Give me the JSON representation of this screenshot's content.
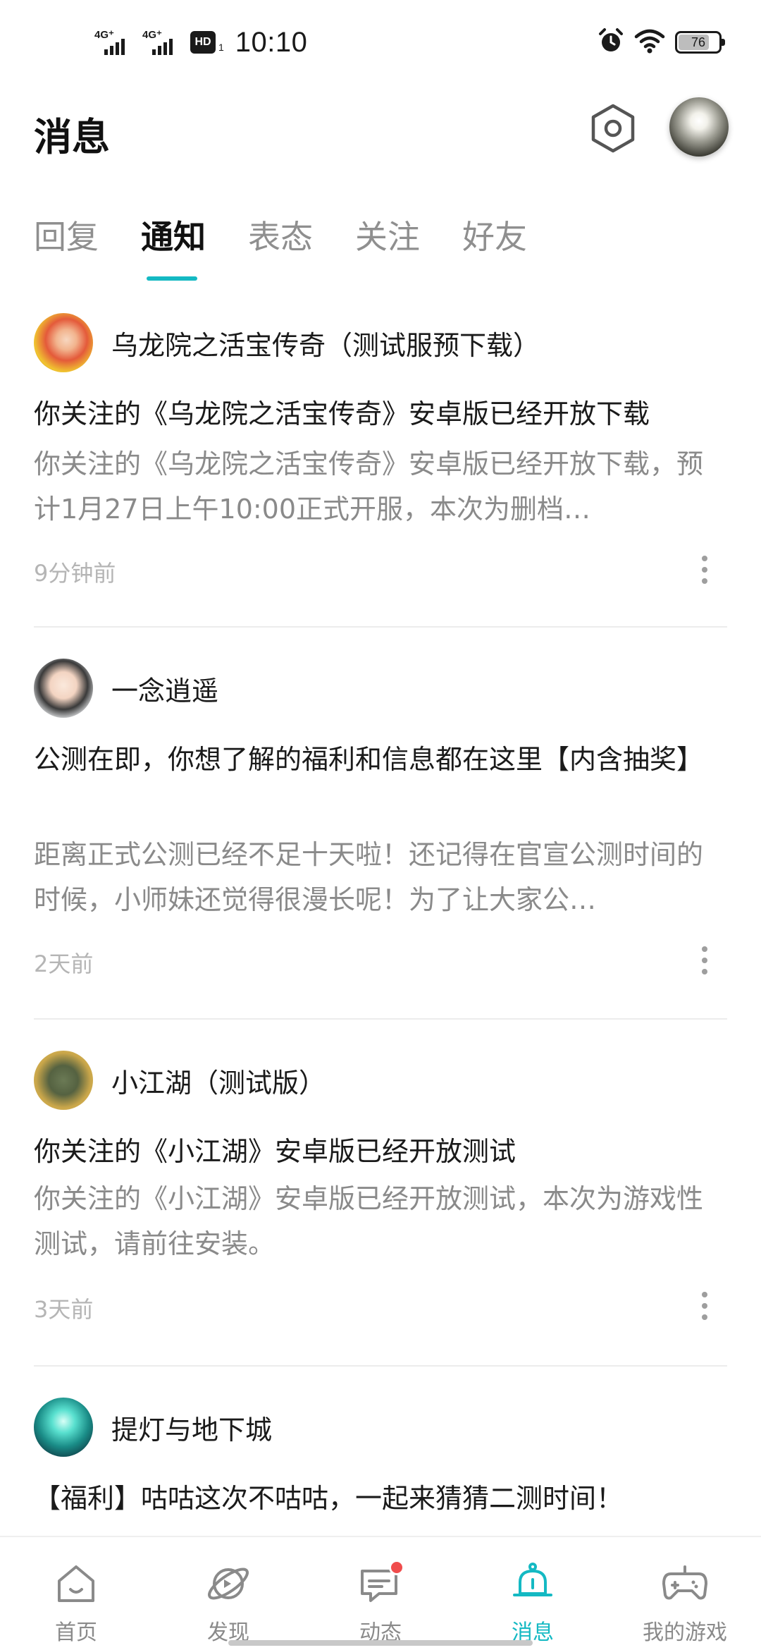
{
  "status_bar": {
    "net1": "4G⁺",
    "net2": "4G⁺",
    "hd": "HD",
    "sim": "1",
    "time": "10:10",
    "battery": "76",
    "battery_level": 0.76
  },
  "header": {
    "title": "消息"
  },
  "tabs": [
    {
      "label": "回复",
      "active": false
    },
    {
      "label": "通知",
      "active": true
    },
    {
      "label": "表态",
      "active": false
    },
    {
      "label": "关注",
      "active": false
    },
    {
      "label": "好友",
      "active": false
    }
  ],
  "notifications": [
    {
      "source": "乌龙院之活宝传奇（测试服预下载）",
      "title": "你关注的《乌龙院之活宝传奇》安卓版已经开放下载",
      "body": "你关注的《乌龙院之活宝传奇》安卓版已经开放下载，预计1月27日上午10:00正式开服，本次为删档…",
      "time": "9分钟前"
    },
    {
      "source": "一念逍遥",
      "title": "公测在即，你想了解的福利和信息都在这里【内含抽奖】",
      "body": "距离正式公测已经不足十天啦！还记得在官宣公测时间的时候，小师妹还觉得很漫长呢！为了让大家公…",
      "time": "2天前"
    },
    {
      "source": "小江湖（测试版）",
      "title": "你关注的《小江湖》安卓版已经开放测试",
      "body": "你关注的《小江湖》安卓版已经开放测试，本次为游戏性测试，请前往安装。",
      "time": "3天前"
    },
    {
      "source": "提灯与地下城",
      "title": "【福利】咕咕这次不咕咕，一起来猜猜二测时间！"
    }
  ],
  "bottom_nav": [
    {
      "label": "首页",
      "icon": "home-icon"
    },
    {
      "label": "发现",
      "icon": "planet-icon"
    },
    {
      "label": "动态",
      "icon": "chat-icon"
    },
    {
      "label": "消息",
      "icon": "bell-icon"
    },
    {
      "label": "我的游戏",
      "icon": "gamepad-icon"
    }
  ],
  "colors": {
    "accent": "#14b9c3",
    "badge": "#f04c4c"
  }
}
